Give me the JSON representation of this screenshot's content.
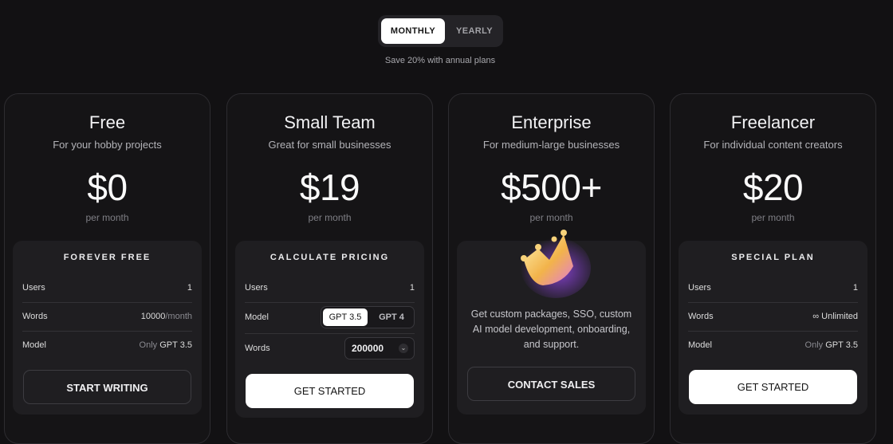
{
  "billing_toggle": {
    "monthly": "MONTHLY",
    "yearly": "YEARLY",
    "selected": "MONTHLY"
  },
  "save_note": "Save 20% with annual plans",
  "plans": [
    {
      "title": "Free",
      "subtitle": "For your hobby projects",
      "price": "$0",
      "period": "per month",
      "panel_heading": "FOREVER FREE",
      "users_label": "Users",
      "users_value": "1",
      "words_label": "Words",
      "words_value": "10000",
      "words_unit": "/month",
      "model_label": "Model",
      "model_prefix": "Only",
      "model_value": "GPT 3.5",
      "cta": "START WRITING"
    },
    {
      "title": "Small Team",
      "subtitle": "Great for small businesses",
      "price": "$19",
      "period": "per month",
      "panel_heading": "CALCULATE PRICING",
      "users_label": "Users",
      "users_value": "1",
      "model_label": "Model",
      "model_options": [
        "GPT 3.5",
        "GPT 4"
      ],
      "model_selected": "GPT 3.5",
      "words_label": "Words",
      "words_value": "200000",
      "cta": "GET STARTED"
    },
    {
      "title": "Enterprise",
      "subtitle": "For medium-large businesses",
      "price": "$500+",
      "period": "per month",
      "description": "Get custom packages, SSO, custom AI model development, onboarding, and support.",
      "icon": "crown-icon",
      "cta": "CONTACT SALES"
    },
    {
      "title": "Freelancer",
      "subtitle": "For individual content creators",
      "price": "$20",
      "period": "per month",
      "panel_heading": "SPECIAL PLAN",
      "users_label": "Users",
      "users_value": "1",
      "words_label": "Words",
      "words_value": "∞ Unlimited",
      "model_label": "Model",
      "model_prefix": "Only",
      "model_value": "GPT 3.5",
      "cta": "GET STARTED"
    }
  ],
  "colors": {
    "background": "#121113",
    "card": "#151416",
    "panel": "#1f1e21",
    "accent_white": "#ffffff"
  }
}
